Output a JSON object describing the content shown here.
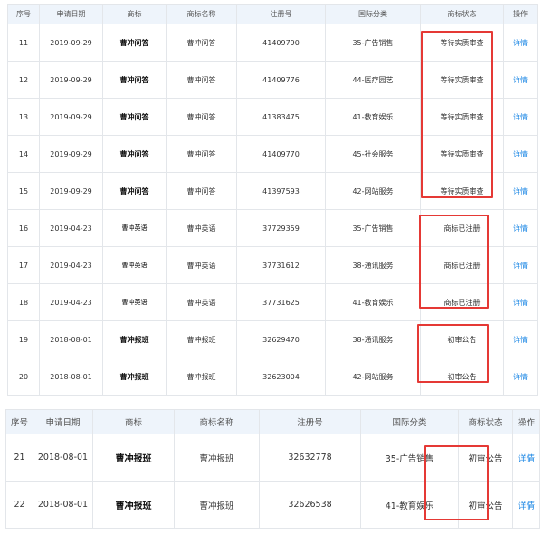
{
  "headers": [
    "序号",
    "申请日期",
    "商标",
    "商标名称",
    "注册号",
    "国际分类",
    "商标状态",
    "操作"
  ],
  "table1": {
    "rows": [
      {
        "no": "11",
        "date": "2019-09-29",
        "mark": "曹冲问答",
        "name": "曹冲问答",
        "reg": "41409790",
        "cls": "35-广告销售",
        "status": "等待实质审查",
        "op": "详情"
      },
      {
        "no": "12",
        "date": "2019-09-29",
        "mark": "曹冲问答",
        "name": "曹冲问答",
        "reg": "41409776",
        "cls": "44-医疗园艺",
        "status": "等待实质审查",
        "op": "详情"
      },
      {
        "no": "13",
        "date": "2019-09-29",
        "mark": "曹冲问答",
        "name": "曹冲问答",
        "reg": "41383475",
        "cls": "41-教育娱乐",
        "status": "等待实质审查",
        "op": "详情"
      },
      {
        "no": "14",
        "date": "2019-09-29",
        "mark": "曹冲问答",
        "name": "曹冲问答",
        "reg": "41409770",
        "cls": "45-社会服务",
        "status": "等待实质审查",
        "op": "详情"
      },
      {
        "no": "15",
        "date": "2019-09-29",
        "mark": "曹冲问答",
        "name": "曹冲问答",
        "reg": "41397593",
        "cls": "42-网站服务",
        "status": "等待实质审查",
        "op": "详情"
      },
      {
        "no": "16",
        "date": "2019-04-23",
        "mark": "曹冲英语",
        "name": "曹冲英语",
        "reg": "37729359",
        "cls": "35-广告销售",
        "status": "商标已注册",
        "op": "详情"
      },
      {
        "no": "17",
        "date": "2019-04-23",
        "mark": "曹冲英语",
        "name": "曹冲英语",
        "reg": "37731612",
        "cls": "38-通讯服务",
        "status": "商标已注册",
        "op": "详情"
      },
      {
        "no": "18",
        "date": "2019-04-23",
        "mark": "曹冲英语",
        "name": "曹冲英语",
        "reg": "37731625",
        "cls": "41-教育娱乐",
        "status": "商标已注册",
        "op": "详情"
      },
      {
        "no": "19",
        "date": "2018-08-01",
        "mark": "曹冲报班",
        "name": "曹冲报班",
        "reg": "32629470",
        "cls": "38-通讯服务",
        "status": "初审公告",
        "op": "详情"
      },
      {
        "no": "20",
        "date": "2018-08-01",
        "mark": "曹冲报班",
        "name": "曹冲报班",
        "reg": "32623004",
        "cls": "42-网站服务",
        "status": "初审公告",
        "op": "详情"
      }
    ]
  },
  "table2": {
    "rows": [
      {
        "no": "21",
        "date": "2018-08-01",
        "mark": "曹冲报班",
        "name": "曹冲报班",
        "reg": "32632778",
        "cls": "35-广告销售",
        "status": "初审公告",
        "op": "详情"
      },
      {
        "no": "22",
        "date": "2018-08-01",
        "mark": "曹冲报班",
        "name": "曹冲报班",
        "reg": "32626538",
        "cls": "41-教育娱乐",
        "status": "初审公告",
        "op": "详情"
      }
    ]
  },
  "colors": {
    "header_bg": "#eef4fb",
    "border": "#e3e6ea",
    "link": "#1e88e5",
    "highlight": "#e53935"
  }
}
